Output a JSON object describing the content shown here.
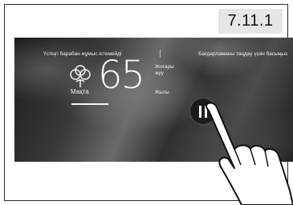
{
  "section_number": "7.11.1",
  "header": {
    "left_text": "Үстіңгі барабан жұмыс істемейді",
    "right_text": "Бағдарламаны таңдау үшін басыңыз"
  },
  "program": {
    "mode_label": "Мақта",
    "mode_icon": "cotton-icon",
    "temperature_value": "65",
    "temperature_words": [
      "Жоғары",
      "жуу"
    ],
    "temperature_unit": "Жылы"
  },
  "controls": {
    "pause_icon": "pause-icon"
  },
  "colors": {
    "screen_bg": "#2a2a2a",
    "text": "#f0f0f0",
    "button": "#1c1c1c"
  }
}
